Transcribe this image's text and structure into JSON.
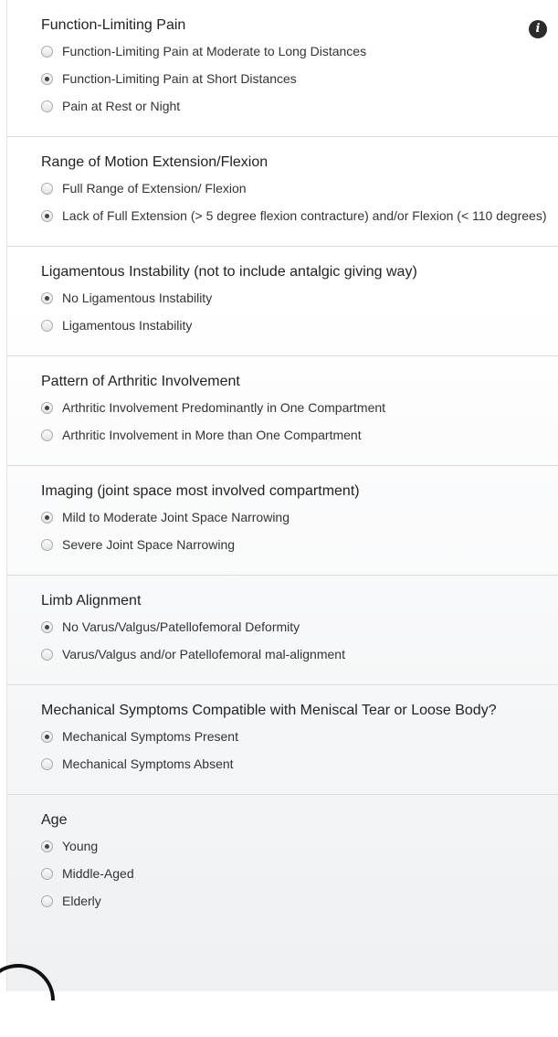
{
  "info_icon": "info-icon",
  "sections": [
    {
      "title": "Function-Limiting Pain",
      "options": [
        {
          "label": "Function-Limiting Pain at Moderate to Long Distances",
          "selected": false
        },
        {
          "label": "Function-Limiting Pain at Short Distances",
          "selected": true
        },
        {
          "label": "Pain at Rest or Night",
          "selected": false
        }
      ]
    },
    {
      "title": "Range of Motion Extension/Flexion",
      "options": [
        {
          "label": "Full Range of Extension/ Flexion",
          "selected": false
        },
        {
          "label": "Lack of Full Extension (> 5 degree flexion contracture) and/or Flexion (< 110 degrees)",
          "selected": true
        }
      ]
    },
    {
      "title": "Ligamentous Instability (not to include antalgic giving way)",
      "options": [
        {
          "label": "No Ligamentous Instability",
          "selected": true
        },
        {
          "label": "Ligamentous Instability",
          "selected": false
        }
      ]
    },
    {
      "title": "Pattern of Arthritic Involvement",
      "options": [
        {
          "label": "Arthritic Involvement Predominantly in One Compartment",
          "selected": true
        },
        {
          "label": "Arthritic Involvement in More than One Compartment",
          "selected": false
        }
      ]
    },
    {
      "title": "Imaging (joint space most involved compartment)",
      "options": [
        {
          "label": "Mild to Moderate Joint Space Narrowing",
          "selected": true
        },
        {
          "label": "Severe Joint Space Narrowing",
          "selected": false
        }
      ]
    },
    {
      "title": "Limb Alignment",
      "options": [
        {
          "label": "No Varus/Valgus/Patellofemoral Deformity",
          "selected": true
        },
        {
          "label": "Varus/Valgus and/or Patellofemoral mal-alignment",
          "selected": false
        }
      ]
    },
    {
      "title": "Mechanical Symptoms Compatible with Meniscal Tear or Loose Body?",
      "options": [
        {
          "label": "Mechanical Symptoms Present",
          "selected": true
        },
        {
          "label": "Mechanical Symptoms Absent",
          "selected": false
        }
      ]
    },
    {
      "title": "Age",
      "options": [
        {
          "label": "Young",
          "selected": true
        },
        {
          "label": "Middle-Aged",
          "selected": false
        },
        {
          "label": "Elderly",
          "selected": false
        }
      ]
    }
  ]
}
